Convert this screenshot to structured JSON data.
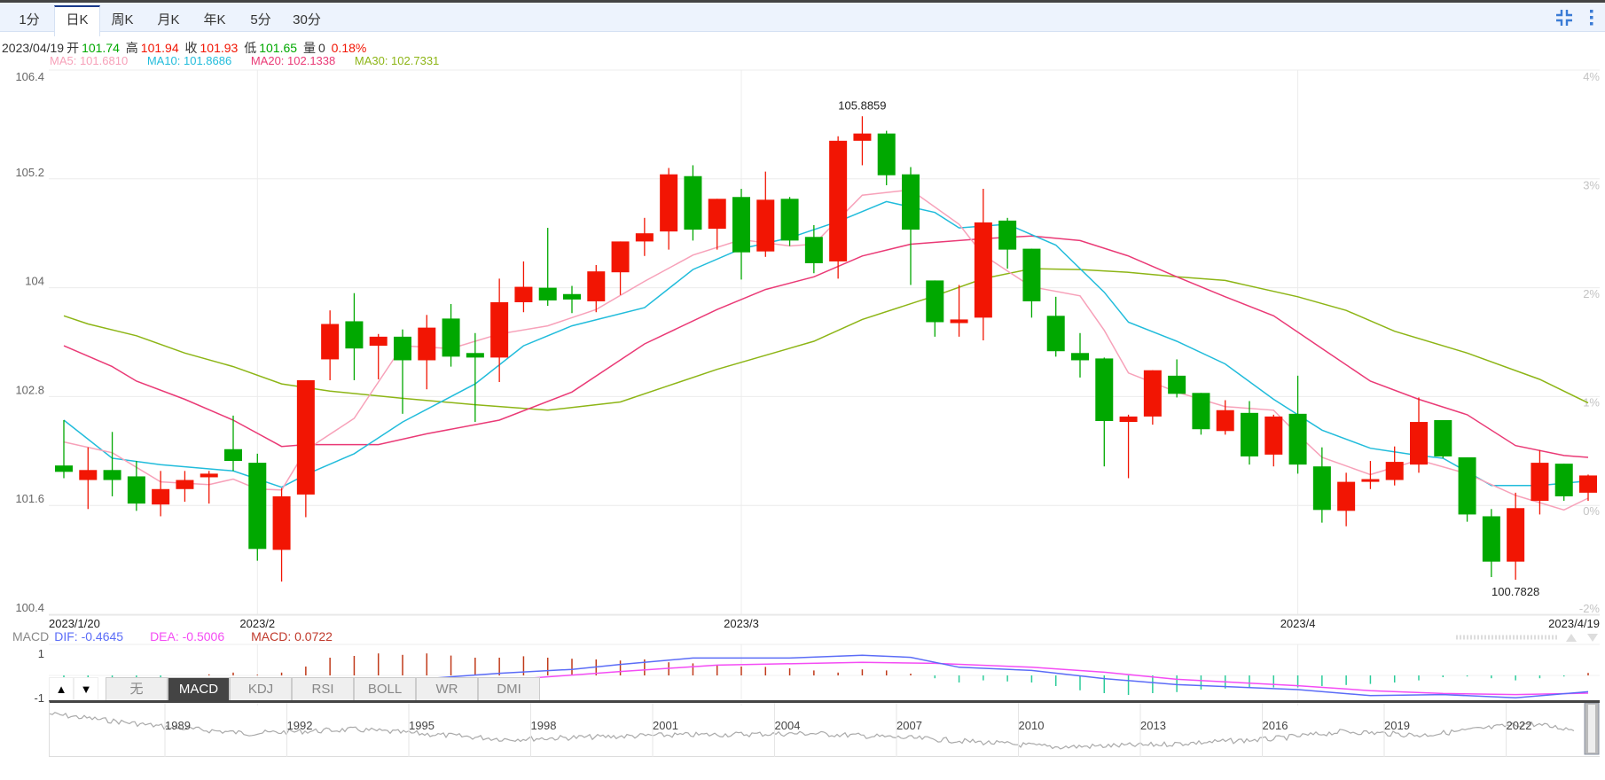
{
  "period_tabs": [
    {
      "label": "1分",
      "active": false
    },
    {
      "label": "日K",
      "active": true
    },
    {
      "label": "周K",
      "active": false
    },
    {
      "label": "月K",
      "active": false
    },
    {
      "label": "年K",
      "active": false
    },
    {
      "label": "5分",
      "active": false
    },
    {
      "label": "30分",
      "active": false
    }
  ],
  "toolbar_icons": [
    "collapse-icon",
    "more-vertical-icon"
  ],
  "info": {
    "date": "2023/04/19",
    "open_label": "开",
    "open": "101.74",
    "high_label": "高",
    "high": "101.94",
    "close_label": "收",
    "close": "101.93",
    "low_label": "低",
    "low": "101.65",
    "volume_label": "量",
    "volume": "0",
    "change": "0.18%"
  },
  "ma_legend": {
    "ma5": "MA5: 101.6810",
    "ma10": "MA10: 101.8686",
    "ma20": "MA20: 102.1338",
    "ma30": "MA30: 102.7331"
  },
  "macd_legend": {
    "title": "MACD",
    "dif": "DIF: -0.4645",
    "dea": "DEA: -0.5006",
    "macd": "MACD: 0.0722"
  },
  "colors": {
    "up": "#f21503",
    "down": "#00a800",
    "ma5": "#f7a1b9",
    "ma10": "#21bcdb",
    "ma20": "#ea3a76",
    "ma30": "#8db516",
    "dif": "#5b6cf7",
    "dea": "#f44cf4",
    "hist_up": "#c03a1a",
    "hist_down": "#2ccc9a"
  },
  "indicator_tabs": [
    {
      "label": "无",
      "active": false
    },
    {
      "label": "MACD",
      "active": true
    },
    {
      "label": "KDJ",
      "active": false
    },
    {
      "label": "RSI",
      "active": false
    },
    {
      "label": "BOLL",
      "active": false
    },
    {
      "label": "WR",
      "active": false
    },
    {
      "label": "DMI",
      "active": false
    }
  ],
  "scroll_arrows": {
    "up": "▲",
    "down": "▼"
  },
  "navigator_years": [
    "1989",
    "1992",
    "1995",
    "1998",
    "2001",
    "2004",
    "2007",
    "2010",
    "2013",
    "2016",
    "2019",
    "2022"
  ],
  "chart_data": {
    "type": "candlestick",
    "ylim": [
      100.4,
      106.4
    ],
    "y_ticks": [
      "106.4",
      "105.2",
      "104",
      "102.8",
      "101.6",
      "100.4"
    ],
    "percent_ticks": [
      "4%",
      "3%",
      "2%",
      "1%",
      "0%",
      "-2%"
    ],
    "x_ticks": [
      {
        "label": "2023/1/20",
        "index": 0
      },
      {
        "label": "2023/2",
        "index": 8
      },
      {
        "label": "2023/3",
        "index": 28
      },
      {
        "label": "2023/4",
        "index": 51
      },
      {
        "label": "2023/4/19",
        "index": 63
      }
    ],
    "annotations": [
      {
        "label": "105.8859",
        "index": 33,
        "value": 105.8859,
        "position": "above"
      },
      {
        "label": "100.7828",
        "index": 60,
        "value": 100.7828,
        "position": "below"
      }
    ],
    "ohlc": [
      [
        102.04,
        102.54,
        101.9,
        101.97
      ],
      [
        101.88,
        102.24,
        101.56,
        101.99
      ],
      [
        101.99,
        102.41,
        101.7,
        101.88
      ],
      [
        101.92,
        102.09,
        101.54,
        101.62
      ],
      [
        101.61,
        101.98,
        101.48,
        101.78
      ],
      [
        101.78,
        101.98,
        101.64,
        101.88
      ],
      [
        101.91,
        101.98,
        101.62,
        101.95
      ],
      [
        102.22,
        102.59,
        101.98,
        102.09
      ],
      [
        102.07,
        102.17,
        100.99,
        101.12
      ],
      [
        101.11,
        101.79,
        100.76,
        101.7
      ],
      [
        101.72,
        102.98,
        101.47,
        102.98
      ],
      [
        103.21,
        103.75,
        102.98,
        103.6
      ],
      [
        103.63,
        103.94,
        102.98,
        103.33
      ],
      [
        103.36,
        103.49,
        102.99,
        103.46
      ],
      [
        103.46,
        103.54,
        102.61,
        103.2
      ],
      [
        103.2,
        103.7,
        102.88,
        103.56
      ],
      [
        103.66,
        103.82,
        103.13,
        103.24
      ],
      [
        103.28,
        103.5,
        102.52,
        103.23
      ],
      [
        103.23,
        104.1,
        102.96,
        103.84
      ],
      [
        103.84,
        104.29,
        103.73,
        104.01
      ],
      [
        104.0,
        104.66,
        103.8,
        103.86
      ],
      [
        103.93,
        104.02,
        103.72,
        103.87
      ],
      [
        103.85,
        104.25,
        103.73,
        104.18
      ],
      [
        104.17,
        104.51,
        103.92,
        104.51
      ],
      [
        104.51,
        104.77,
        104.35,
        104.6
      ],
      [
        104.62,
        105.32,
        104.42,
        105.25
      ],
      [
        105.23,
        105.35,
        104.52,
        104.64
      ],
      [
        104.65,
        104.98,
        104.42,
        104.98
      ],
      [
        105.0,
        105.09,
        104.09,
        104.39
      ],
      [
        104.4,
        105.28,
        104.34,
        104.97
      ],
      [
        104.98,
        105.0,
        104.46,
        104.52
      ],
      [
        104.56,
        104.69,
        104.16,
        104.27
      ],
      [
        104.29,
        105.67,
        104.1,
        105.62
      ],
      [
        105.62,
        105.89,
        105.35,
        105.7
      ],
      [
        105.7,
        105.73,
        105.13,
        105.24
      ],
      [
        105.25,
        105.33,
        104.03,
        104.64
      ],
      [
        104.08,
        104.08,
        103.46,
        103.62
      ],
      [
        103.61,
        104.03,
        103.46,
        103.65
      ],
      [
        103.67,
        105.09,
        103.42,
        104.72
      ],
      [
        104.74,
        104.77,
        104.21,
        104.42
      ],
      [
        104.43,
        104.43,
        103.67,
        103.85
      ],
      [
        103.69,
        103.9,
        103.24,
        103.3
      ],
      [
        103.28,
        103.5,
        103.01,
        103.2
      ],
      [
        103.22,
        103.23,
        102.03,
        102.53
      ],
      [
        102.52,
        102.6,
        101.9,
        102.58
      ],
      [
        102.58,
        103.09,
        102.49,
        103.09
      ],
      [
        103.03,
        103.21,
        102.79,
        102.83
      ],
      [
        102.84,
        102.84,
        102.38,
        102.44
      ],
      [
        102.42,
        102.76,
        102.38,
        102.65
      ],
      [
        102.62,
        102.75,
        102.05,
        102.14
      ],
      [
        102.16,
        102.6,
        102.03,
        102.58
      ],
      [
        102.61,
        103.03,
        101.95,
        102.05
      ],
      [
        102.03,
        102.24,
        101.41,
        101.55
      ],
      [
        101.54,
        101.96,
        101.37,
        101.86
      ],
      [
        101.86,
        102.09,
        101.78,
        101.89
      ],
      [
        101.88,
        102.25,
        101.82,
        102.08
      ],
      [
        102.05,
        102.79,
        101.96,
        102.52
      ],
      [
        102.54,
        102.54,
        102.12,
        102.14
      ],
      [
        102.13,
        102.13,
        101.42,
        101.5
      ],
      [
        101.48,
        101.56,
        100.81,
        100.98
      ],
      [
        100.98,
        101.74,
        100.78,
        101.57
      ],
      [
        101.65,
        102.21,
        101.5,
        102.07
      ],
      [
        102.06,
        102.06,
        101.65,
        101.7
      ],
      [
        101.74,
        101.94,
        101.65,
        101.93
      ]
    ],
    "ma5": [
      [
        0,
        102.3
      ],
      [
        2,
        102.18
      ],
      [
        4,
        101.86
      ],
      [
        6,
        101.83
      ],
      [
        7,
        101.89
      ],
      [
        8,
        101.78
      ],
      [
        9,
        101.77
      ],
      [
        10,
        102.21
      ],
      [
        12,
        102.56
      ],
      [
        14,
        103.36
      ],
      [
        16,
        103.33
      ],
      [
        18,
        103.49
      ],
      [
        20,
        103.58
      ],
      [
        22,
        103.76
      ],
      [
        24,
        104.07
      ],
      [
        26,
        104.36
      ],
      [
        28,
        104.53
      ],
      [
        30,
        104.46
      ],
      [
        31,
        104.48
      ],
      [
        33,
        105.02
      ],
      [
        35,
        105.08
      ],
      [
        37,
        104.7
      ],
      [
        38,
        104.36
      ],
      [
        40,
        104.01
      ],
      [
        42,
        103.91
      ],
      [
        43,
        103.53
      ],
      [
        44,
        103.06
      ],
      [
        46,
        102.85
      ],
      [
        48,
        102.69
      ],
      [
        50,
        102.65
      ],
      [
        51,
        102.38
      ],
      [
        52,
        102.13
      ],
      [
        54,
        101.94
      ],
      [
        56,
        102.1
      ],
      [
        58,
        101.95
      ],
      [
        60,
        101.71
      ],
      [
        62,
        101.55
      ],
      [
        63,
        101.68
      ]
    ],
    "ma10": [
      [
        0,
        102.54
      ],
      [
        2,
        102.12
      ],
      [
        4,
        102.05
      ],
      [
        7,
        101.98
      ],
      [
        9,
        101.8
      ],
      [
        10,
        101.94
      ],
      [
        12,
        102.17
      ],
      [
        14,
        102.52
      ],
      [
        17,
        102.94
      ],
      [
        19,
        103.36
      ],
      [
        21,
        103.58
      ],
      [
        24,
        103.78
      ],
      [
        26,
        104.2
      ],
      [
        28,
        104.43
      ],
      [
        30,
        104.55
      ],
      [
        32,
        104.73
      ],
      [
        34,
        104.95
      ],
      [
        36,
        104.83
      ],
      [
        37,
        104.66
      ],
      [
        39,
        104.7
      ],
      [
        41,
        104.47
      ],
      [
        43,
        103.95
      ],
      [
        44,
        103.62
      ],
      [
        46,
        103.41
      ],
      [
        48,
        103.16
      ],
      [
        50,
        102.77
      ],
      [
        52,
        102.43
      ],
      [
        54,
        102.23
      ],
      [
        56,
        102.15
      ],
      [
        57,
        102.12
      ],
      [
        59,
        101.82
      ],
      [
        61,
        101.82
      ],
      [
        63,
        101.87
      ]
    ],
    "ma20": [
      [
        0,
        103.36
      ],
      [
        2,
        103.13
      ],
      [
        3,
        102.97
      ],
      [
        5,
        102.77
      ],
      [
        7,
        102.54
      ],
      [
        9,
        102.25
      ],
      [
        10,
        102.27
      ],
      [
        13,
        102.27
      ],
      [
        15,
        102.39
      ],
      [
        18,
        102.54
      ],
      [
        21,
        102.85
      ],
      [
        24,
        103.38
      ],
      [
        27,
        103.76
      ],
      [
        29,
        103.98
      ],
      [
        31,
        104.12
      ],
      [
        33,
        104.35
      ],
      [
        35,
        104.48
      ],
      [
        38,
        104.54
      ],
      [
        40,
        104.57
      ],
      [
        42,
        104.52
      ],
      [
        44,
        104.35
      ],
      [
        46,
        104.12
      ],
      [
        48,
        103.9
      ],
      [
        50,
        103.69
      ],
      [
        52,
        103.33
      ],
      [
        54,
        102.97
      ],
      [
        56,
        102.77
      ],
      [
        58,
        102.6
      ],
      [
        60,
        102.26
      ],
      [
        62,
        102.15
      ],
      [
        63,
        102.13
      ]
    ],
    "ma30": [
      [
        0,
        103.69
      ],
      [
        1,
        103.6
      ],
      [
        3,
        103.47
      ],
      [
        5,
        103.28
      ],
      [
        7,
        103.13
      ],
      [
        9,
        102.94
      ],
      [
        11,
        102.86
      ],
      [
        14,
        102.78
      ],
      [
        17,
        102.71
      ],
      [
        20,
        102.65
      ],
      [
        23,
        102.74
      ],
      [
        25,
        102.92
      ],
      [
        27,
        103.1
      ],
      [
        31,
        103.41
      ],
      [
        33,
        103.65
      ],
      [
        36,
        103.91
      ],
      [
        38,
        104.1
      ],
      [
        40,
        104.21
      ],
      [
        42,
        104.2
      ],
      [
        44,
        104.17
      ],
      [
        46,
        104.12
      ],
      [
        48,
        104.08
      ],
      [
        51,
        103.9
      ],
      [
        53,
        103.75
      ],
      [
        55,
        103.52
      ],
      [
        58,
        103.28
      ],
      [
        61,
        102.99
      ],
      [
        63,
        102.73
      ]
    ],
    "macd": {
      "y_ticks": [
        "1",
        "-1"
      ],
      "dif": [
        [
          0,
          -0.74
        ],
        [
          6,
          -0.74
        ],
        [
          8,
          -0.66
        ],
        [
          10,
          -0.57
        ],
        [
          12,
          -0.37
        ],
        [
          14,
          -0.14
        ],
        [
          18,
          0.06
        ],
        [
          21,
          0.17
        ],
        [
          23,
          0.31
        ],
        [
          26,
          0.49
        ],
        [
          30,
          0.49
        ],
        [
          33,
          0.57
        ],
        [
          35,
          0.51
        ],
        [
          37,
          0.23
        ],
        [
          40,
          0.14
        ],
        [
          43,
          -0.09
        ],
        [
          46,
          -0.26
        ],
        [
          51,
          -0.4
        ],
        [
          54,
          -0.57
        ],
        [
          57,
          -0.54
        ],
        [
          60,
          -0.63
        ],
        [
          63,
          -0.46
        ]
      ],
      "dea": [
        [
          0,
          -0.74
        ],
        [
          8,
          -0.74
        ],
        [
          14,
          -0.4
        ],
        [
          18,
          -0.14
        ],
        [
          23,
          0.11
        ],
        [
          27,
          0.29
        ],
        [
          33,
          0.37
        ],
        [
          36,
          0.34
        ],
        [
          40,
          0.23
        ],
        [
          43,
          0.09
        ],
        [
          46,
          -0.11
        ],
        [
          51,
          -0.29
        ],
        [
          54,
          -0.43
        ],
        [
          57,
          -0.51
        ],
        [
          60,
          -0.54
        ],
        [
          63,
          -0.5
        ]
      ],
      "histogram": [
        -0.08,
        -0.08,
        -0.07,
        -0.07,
        -0.05,
        0,
        0.03,
        0.08,
        0.02,
        0.08,
        0.25,
        0.5,
        0.55,
        0.62,
        0.58,
        0.62,
        0.56,
        0.5,
        0.5,
        0.54,
        0.5,
        0.47,
        0.45,
        0.42,
        0.45,
        0.37,
        0.34,
        0.3,
        0.25,
        0.24,
        0.2,
        0.14,
        0.08,
        0.17,
        0.14,
        0.05,
        -0.08,
        -0.2,
        -0.14,
        -0.17,
        -0.2,
        -0.3,
        -0.42,
        -0.5,
        -0.55,
        -0.5,
        -0.47,
        -0.4,
        -0.37,
        -0.34,
        -0.34,
        -0.34,
        -0.3,
        -0.27,
        -0.24,
        -0.2,
        -0.14,
        -0.05,
        -0.03,
        -0.08,
        -0.14,
        -0.08,
        -0.03,
        0.07
      ]
    }
  }
}
